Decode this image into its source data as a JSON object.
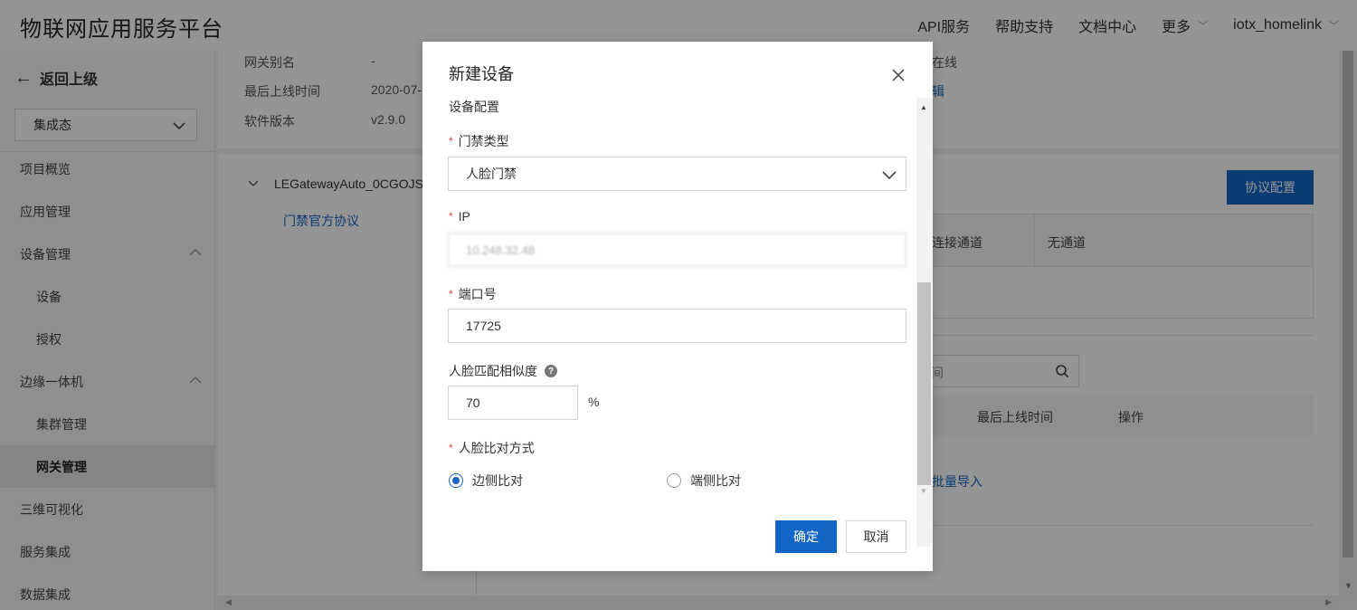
{
  "header": {
    "brand": "物联网应用服务平台",
    "nav": [
      {
        "label": "API服务"
      },
      {
        "label": "帮助支持"
      },
      {
        "label": "文档中心"
      },
      {
        "label": "更多"
      },
      {
        "label": "iotx_homelink"
      }
    ]
  },
  "sidebar": {
    "back_label": "返回上级",
    "select_value": "集成态",
    "items": [
      {
        "label": "项目概览"
      },
      {
        "label": "应用管理"
      },
      {
        "label": "设备管理"
      },
      {
        "label": "设备"
      },
      {
        "label": "授权"
      },
      {
        "label": "边缘一体机"
      },
      {
        "label": "集群管理"
      },
      {
        "label": "网关管理"
      },
      {
        "label": "三维可视化"
      },
      {
        "label": "服务集成"
      },
      {
        "label": "数据集成"
      }
    ]
  },
  "background": {
    "info": [
      {
        "label": "网关别名",
        "value": "-"
      },
      {
        "label": "最后上线时间",
        "value": "2020-07-"
      },
      {
        "label": "软件版本",
        "value": "v2.9.0"
      }
    ],
    "status_text": "在线",
    "edit_text": "辑",
    "tree_node": "LEGatewayAuto_0CGOJS",
    "tree_child": "门禁官方协议",
    "protocol_button": "协议配置",
    "table1_cols": [
      "连接通道",
      "无通道"
    ],
    "table2_cols": [
      "最后上线时间",
      "操作"
    ],
    "search_placeholder": "间",
    "batch_import": "批量导入"
  },
  "modal": {
    "title": "新建设备",
    "section": "设备配置",
    "door_type": {
      "label": "门禁类型",
      "value": "人脸门禁"
    },
    "ip": {
      "label": "IP",
      "value": "10.248.32.48"
    },
    "port": {
      "label": "端口号",
      "value": "17725"
    },
    "similarity": {
      "label": "人脸匹配相似度",
      "value": "70",
      "unit": "%"
    },
    "compare_mode": {
      "label": "人脸比对方式",
      "options": [
        {
          "label": "边侧比对",
          "checked": true
        },
        {
          "label": "端侧比对",
          "checked": false
        }
      ]
    },
    "confirm": "确定",
    "cancel": "取消"
  },
  "colors": {
    "primary": "#1466c6",
    "required": "#e04040"
  }
}
